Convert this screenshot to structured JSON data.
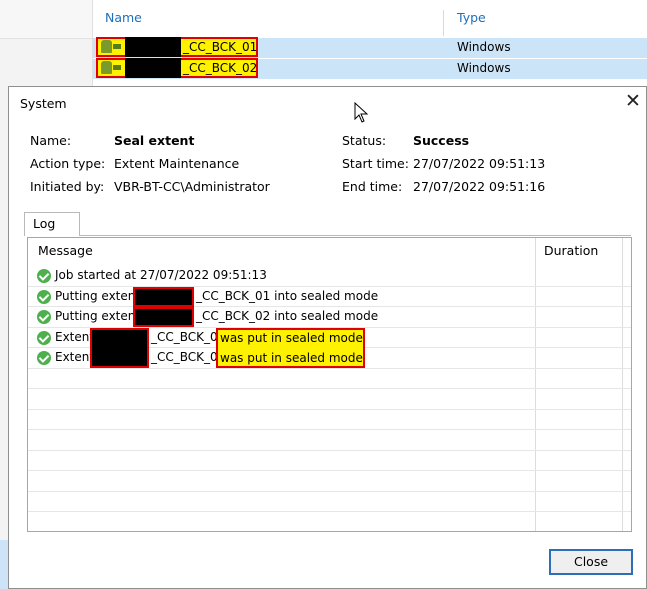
{
  "background": {
    "columns": {
      "name": "Name",
      "type": "Type"
    },
    "rows": [
      {
        "name_suffix": "_CC_BCK_01",
        "type": "Windows"
      },
      {
        "name_suffix": "_CC_BCK_02",
        "type": "Windows"
      }
    ]
  },
  "dialog": {
    "title": "System",
    "info": {
      "name_label": "Name:",
      "name_value": "Seal extent",
      "action_label": "Action type:",
      "action_value": "Extent Maintenance",
      "initiated_label": "Initiated by:",
      "initiated_value": "VBR-BT-CC\\Administrator",
      "status_label": "Status:",
      "status_value": "Success",
      "start_label": "Start time:",
      "start_value": "27/07/2022 09:51:13",
      "end_label": "End time:",
      "end_value": "27/07/2022 09:51:16"
    },
    "tab": "Log",
    "log": {
      "columns": {
        "message": "Message",
        "duration": "Duration"
      },
      "rows": [
        {
          "text": "Job started at 27/07/2022 09:51:13"
        },
        {
          "prefix": "Putting extent",
          "suffix": "_CC_BCK_01 into sealed mode"
        },
        {
          "prefix": "Putting extent",
          "suffix": "_CC_BCK_02 into sealed mode"
        },
        {
          "prefix": "Extent",
          "suffix": "_CC_BCK_01",
          "highlight": "was put in sealed mode"
        },
        {
          "prefix": "Extent",
          "suffix": "_CC_BCK_02",
          "highlight": "was put in sealed mode"
        }
      ]
    },
    "close_button": "Close"
  },
  "colors": {
    "highlight": "#fff200",
    "highlight_border": "#e00000",
    "selection": "#cce4f7",
    "success": "#4db04d",
    "link": "#1f6fba"
  }
}
